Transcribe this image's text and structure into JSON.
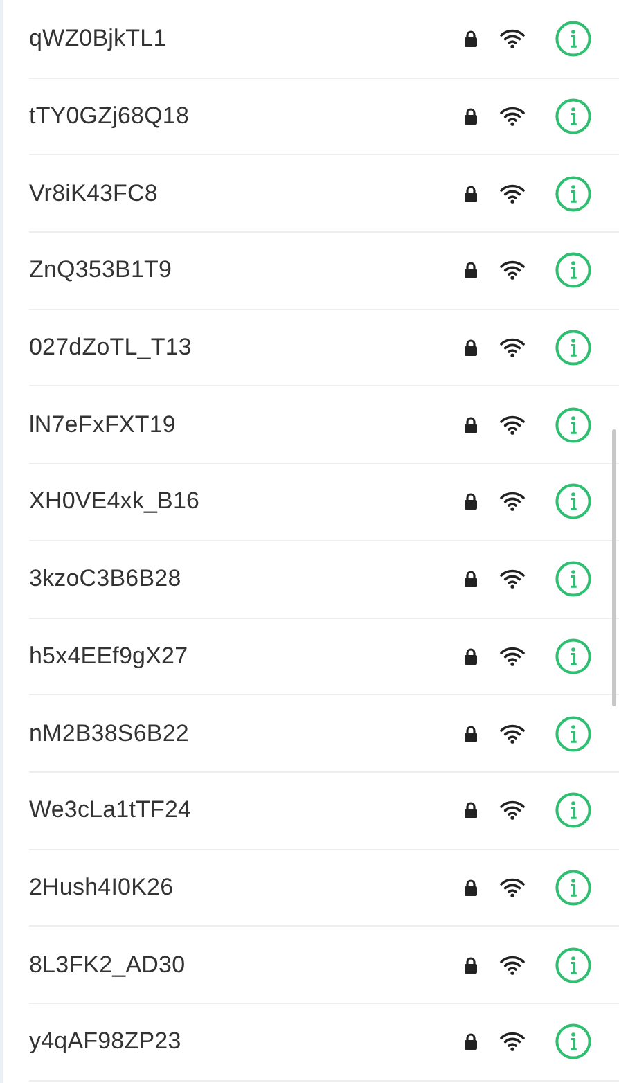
{
  "networks": [
    {
      "name": "qWZ0BjkTL1",
      "locked": true
    },
    {
      "name": "tTY0GZj68Q18",
      "locked": true
    },
    {
      "name": "Vr8iK43FC8",
      "locked": true
    },
    {
      "name": "ZnQ353B1T9",
      "locked": true
    },
    {
      "name": "027dZoTL_T13",
      "locked": true
    },
    {
      "name": "lN7eFxFXT19",
      "locked": true
    },
    {
      "name": "XH0VE4xk_B16",
      "locked": true
    },
    {
      "name": "3kzoC3B6B28",
      "locked": true
    },
    {
      "name": "h5x4EEf9gX27",
      "locked": true
    },
    {
      "name": "nM2B38S6B22",
      "locked": true
    },
    {
      "name": "We3cLa1tTF24",
      "locked": true
    },
    {
      "name": "2Hush4I0K26",
      "locked": true
    },
    {
      "name": "8L3FK2_AD30",
      "locked": true
    },
    {
      "name": "y4qAF98ZP23",
      "locked": true
    }
  ]
}
